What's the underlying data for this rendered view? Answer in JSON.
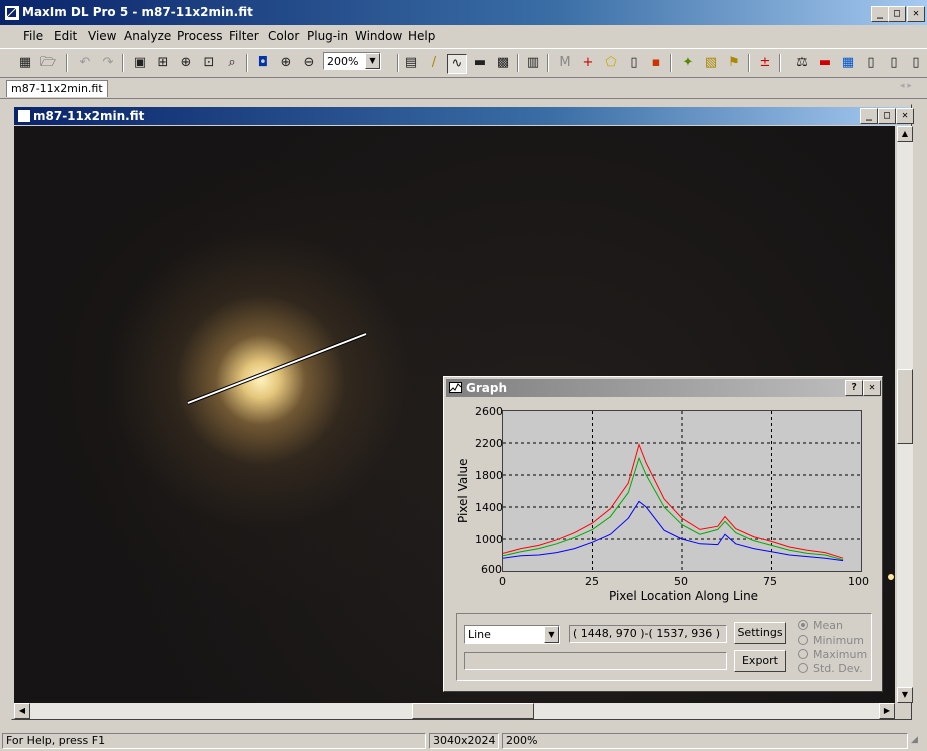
{
  "app": {
    "title": "MaxIm DL Pro 5 - m87-11x2min.fit"
  },
  "menu": [
    "File",
    "Edit",
    "View",
    "Analyze",
    "Process",
    "Filter",
    "Color",
    "Plug-in",
    "Window",
    "Help"
  ],
  "toolbar": {
    "zoom_value": "200%"
  },
  "doc_tab": "m87-11x2min.fit",
  "image_window": {
    "title": "m87-11x2min.fit"
  },
  "graph": {
    "title": "Graph",
    "mode_value": "Line",
    "coords": "( 1448, 970 )-( 1537, 936 )",
    "settings_label": "Settings",
    "export_label": "Export",
    "stat_options": [
      "Mean",
      "Minimum",
      "Maximum",
      "Std. Dev."
    ],
    "selected_stat": "Mean"
  },
  "status": {
    "help": "For Help, press F1",
    "dimensions": "3040x2024",
    "zoom": "200%"
  },
  "chart_data": {
    "type": "line",
    "xlabel": "Pixel Location Along Line",
    "ylabel": "Pixel Value",
    "xlim": [
      0,
      100
    ],
    "ylim": [
      600,
      2600
    ],
    "xticks": [
      0,
      25,
      50,
      75,
      100
    ],
    "yticks": [
      600,
      1000,
      1400,
      1800,
      2200,
      2600
    ],
    "grid": true,
    "x": [
      0,
      5,
      10,
      15,
      20,
      25,
      30,
      35,
      38,
      40,
      45,
      50,
      55,
      60,
      62,
      65,
      70,
      75,
      80,
      85,
      90,
      95
    ],
    "series": [
      {
        "color": "#ff0000",
        "values": [
          820,
          880,
          920,
          990,
          1080,
          1200,
          1380,
          1700,
          2180,
          1950,
          1500,
          1260,
          1120,
          1160,
          1280,
          1130,
          1030,
          970,
          900,
          860,
          830,
          760
        ]
      },
      {
        "color": "#00aa00",
        "values": [
          790,
          840,
          880,
          940,
          1020,
          1120,
          1280,
          1580,
          2010,
          1800,
          1400,
          1180,
          1060,
          1120,
          1220,
          1080,
          980,
          920,
          860,
          820,
          800,
          740
        ]
      },
      {
        "color": "#0000ff",
        "values": [
          760,
          790,
          800,
          830,
          880,
          960,
          1060,
          1260,
          1470,
          1400,
          1110,
          1000,
          940,
          930,
          1060,
          940,
          880,
          840,
          800,
          780,
          760,
          730
        ]
      }
    ]
  }
}
